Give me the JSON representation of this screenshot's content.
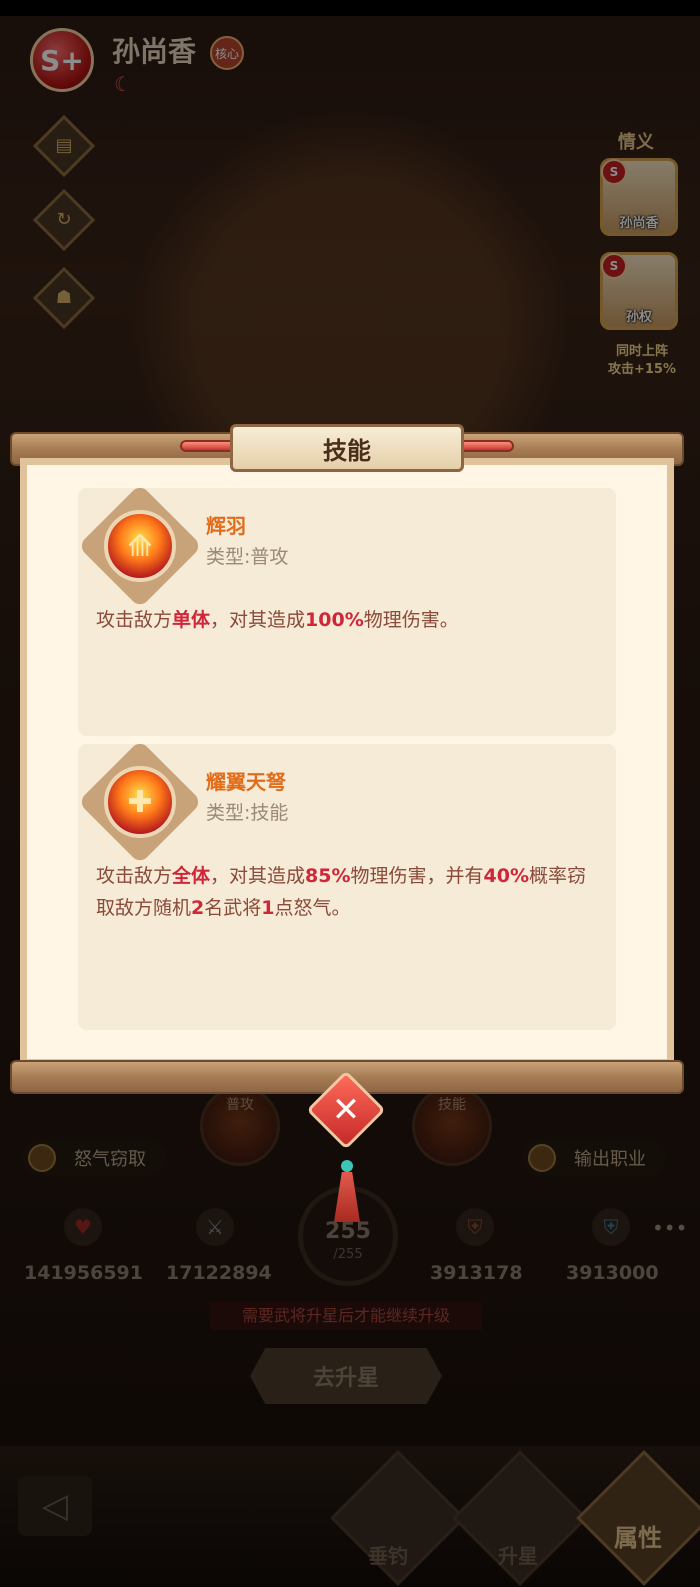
{
  "hero": {
    "rank": "S+",
    "name": "孙尚香",
    "core_badge": "核心"
  },
  "side_icons": [
    "scroll-icon",
    "refresh-icon",
    "helmet-icon"
  ],
  "bond": {
    "title": "情义",
    "cards": [
      {
        "name": "孙尚香",
        "rank": "S"
      },
      {
        "name": "孙权",
        "rank": "S"
      }
    ],
    "bonus_line1": "同时上阵",
    "bonus_line2": "攻击+15%"
  },
  "skill_panel": {
    "title": "技能",
    "skills": [
      {
        "name": "辉羽",
        "type": "类型:普攻",
        "desc": [
          {
            "t": "攻击敌方",
            "hl": false
          },
          {
            "t": "单体",
            "hl": true
          },
          {
            "t": "，对其造成",
            "hl": false
          },
          {
            "t": "100%",
            "hl": true
          },
          {
            "t": "物理伤害。",
            "hl": false
          }
        ]
      },
      {
        "name": "耀翼天弩",
        "type": "类型:技能",
        "desc": [
          {
            "t": "攻击敌方",
            "hl": false
          },
          {
            "t": "全体",
            "hl": true
          },
          {
            "t": "，对其造成",
            "hl": false
          },
          {
            "t": "85%",
            "hl": true
          },
          {
            "t": "物理伤害，并有",
            "hl": false
          },
          {
            "t": "40%",
            "hl": true
          },
          {
            "t": "概率窃取敌方随机",
            "hl": false
          },
          {
            "t": "2",
            "hl": true
          },
          {
            "t": "名武将",
            "hl": false
          },
          {
            "t": "1",
            "hl": true
          },
          {
            "t": "点怒气。",
            "hl": false
          }
        ]
      }
    ]
  },
  "lower": {
    "bubble_labels": [
      "普攻",
      "技能"
    ],
    "trait_left": "怒气窃取",
    "trait_right": "输出职业",
    "stats": [
      "141956591",
      "17122894",
      "3913178",
      "3913000"
    ],
    "level_current": "255",
    "level_max": "/255",
    "notice": "需要武将升星后才能继续升级",
    "star_up_button": "去升星"
  },
  "bottom_nav": {
    "items": [
      "垂钓",
      "升星",
      "属性"
    ],
    "active": "属性"
  },
  "colors": {
    "highlight": "#d0263a",
    "skill_name": "#e16d1b",
    "panel_bg": "#fff6e6"
  }
}
